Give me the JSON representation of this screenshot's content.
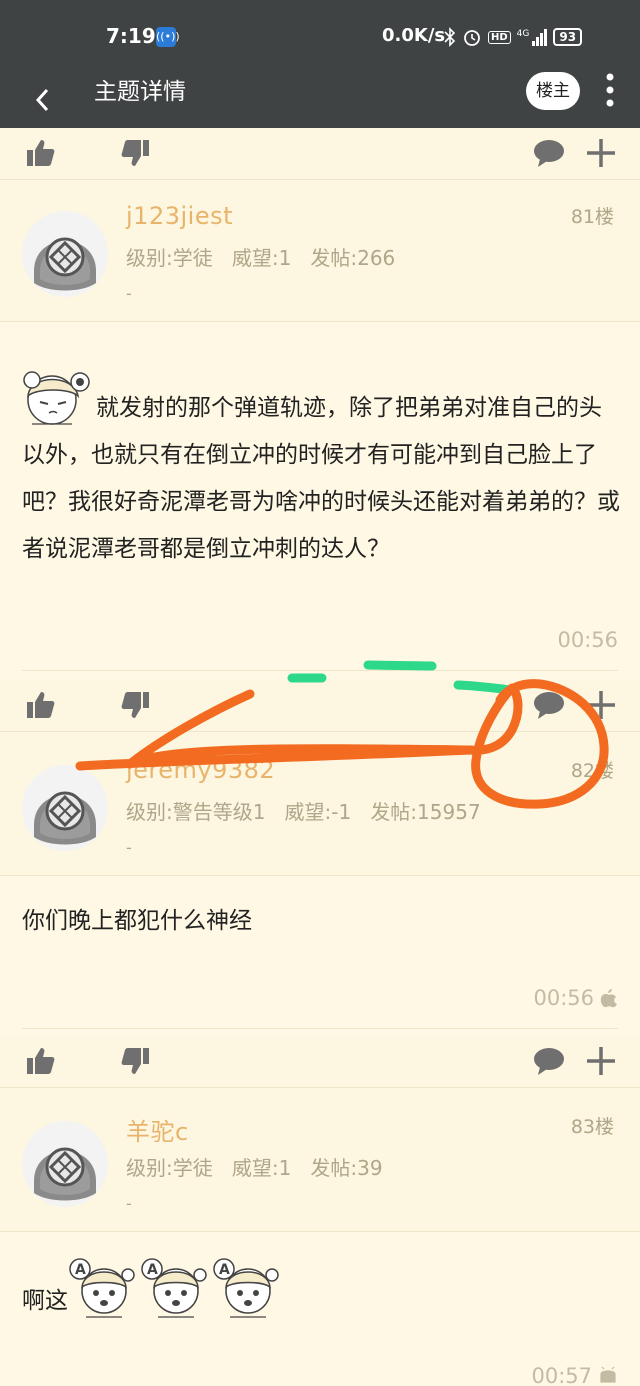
{
  "status_bar": {
    "time": "7:19",
    "net_speed": "0.0K/s",
    "signal_label": "4G",
    "hd_label": "HD",
    "battery": "93"
  },
  "app_bar": {
    "title": "主题详情",
    "louzhu_label": "楼主"
  },
  "posts": [
    {
      "username": "j123jiest",
      "level": "级别:学徒",
      "prestige": "威望:1",
      "post_count": "发帖:266",
      "signature": "-",
      "floor": "81楼",
      "content": "就发射的那个弹道轨迹，除了把弟弟对准自己的头以外，也就只有在倒立冲的时候才有可能冲到自己脸上了吧？我很好奇泥潭老哥为啥冲的时候头还能对着弟弟的？或者说泥潭老哥都是倒立冲刺的达人？",
      "time": "00:56"
    },
    {
      "username": "jeremy9382",
      "level": "级别:警告等级1",
      "prestige": "威望:-1",
      "post_count": "发帖:15957",
      "signature": "-",
      "floor": "82楼",
      "content": "你们晚上都犯什么神经",
      "time": "00:56",
      "device": "apple-icon"
    },
    {
      "username": "羊驼c",
      "level": "级别:学徒",
      "prestige": "威望:1",
      "post_count": "发帖:39",
      "signature": "-",
      "floor": "83楼",
      "content": "啊这",
      "time": "00:57",
      "device": "android-icon"
    }
  ],
  "colors": {
    "appbar": "#3f4343",
    "background": "#fdf6e0",
    "username": "#e8b46b",
    "meta": "#b0a68a",
    "annotation_orange": "#f26b21",
    "annotation_green": "#2ed88a"
  }
}
